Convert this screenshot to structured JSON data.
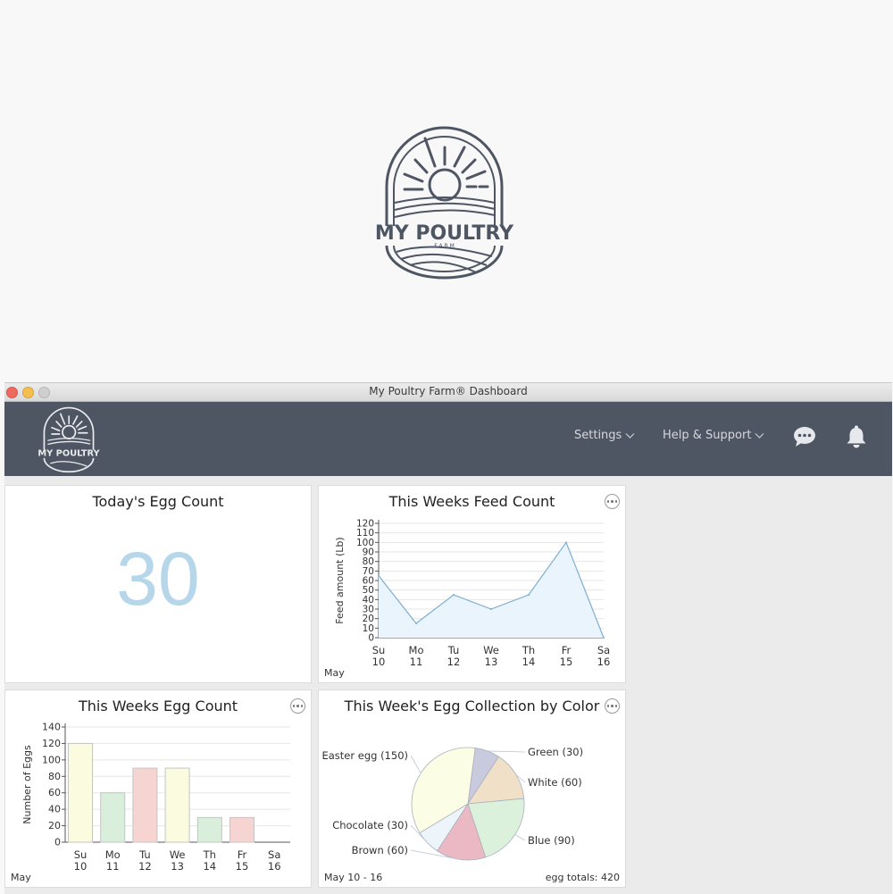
{
  "brand": {
    "logo_main": "MY POULTRY",
    "logo_sub": "F A R M"
  },
  "window": {
    "title": "My Poultry Farm® Dashboard"
  },
  "nav": {
    "settings_label": "Settings",
    "help_label": "Help & Support"
  },
  "icons": {
    "chat": "chat-bubble-icon",
    "notifications": "bell-icon",
    "menu_more": "ellipsis-icon",
    "chevron": "chevron-down-icon"
  },
  "colors": {
    "appbar_bg": "#4e5563",
    "egg_count": "#b6d6ea",
    "line_stroke": "#7eaed0",
    "area_fill": "#eaf4fc"
  },
  "egg_count_panel": {
    "title": "Today's Egg Count",
    "value": "30"
  },
  "feed_panel": {
    "title": "This Weeks Feed Count",
    "footer_month": "May"
  },
  "egg_week_panel": {
    "title": "This Weeks Egg Count",
    "footer_month": "May"
  },
  "color_panel": {
    "title": "This Week's Egg Collection by Color",
    "footer_range": "May 10 - 16",
    "footer_totals": "egg totals: 420"
  },
  "chart_data": [
    {
      "type": "area",
      "title": "This Weeks Feed Count",
      "xlabel": "",
      "ylabel": "Feed amount (Lb)",
      "categories": [
        "Su 10",
        "Mo 11",
        "Tu 12",
        "We 13",
        "Th 14",
        "Fr 15",
        "Sa 16"
      ],
      "day_labels": [
        "Su",
        "Mo",
        "Tu",
        "We",
        "Th",
        "Fr",
        "Sa"
      ],
      "date_labels": [
        "10",
        "11",
        "12",
        "13",
        "14",
        "15",
        "16"
      ],
      "values": [
        65,
        15,
        45,
        30,
        45,
        100,
        0
      ],
      "ylim": [
        0,
        120
      ],
      "yticks": [
        0,
        10,
        20,
        30,
        40,
        50,
        60,
        70,
        80,
        90,
        100,
        110,
        120
      ],
      "grid": true
    },
    {
      "type": "bar",
      "title": "This Weeks Egg Count",
      "xlabel": "",
      "ylabel": "Number of Eggs",
      "categories": [
        "Su 10",
        "Mo 11",
        "Tu 12",
        "We 13",
        "Th 14",
        "Fr 15",
        "Sa 16"
      ],
      "day_labels": [
        "Su",
        "Mo",
        "Tu",
        "We",
        "Th",
        "Fr",
        "Sa"
      ],
      "date_labels": [
        "10",
        "11",
        "12",
        "13",
        "14",
        "15",
        "16"
      ],
      "values": [
        120,
        60,
        90,
        90,
        30,
        30,
        0
      ],
      "bar_colors": [
        "#fbfbe0",
        "#d9eedb",
        "#f6d4d1",
        "#fbfbe0",
        "#d9eedb",
        "#f6d4d1",
        "#fbfbe0"
      ],
      "ylim": [
        0,
        140
      ],
      "yticks": [
        0,
        20,
        40,
        60,
        80,
        100,
        120,
        140
      ],
      "grid": true
    },
    {
      "type": "pie",
      "title": "This Week's Egg Collection by Color",
      "slices": [
        {
          "label": "Green (30)",
          "value": 30,
          "color": "#c9cade"
        },
        {
          "label": "White (60)",
          "value": 60,
          "color": "#f0e0c8"
        },
        {
          "label": "Blue (90)",
          "value": 90,
          "color": "#dcf1dc"
        },
        {
          "label": "Brown (60)",
          "value": 60,
          "color": "#eab9c4"
        },
        {
          "label": "Chocolate (30)",
          "value": 30,
          "color": "#edf5fa"
        },
        {
          "label": "Easter egg (150)",
          "value": 150,
          "color": "#fbfde4"
        }
      ],
      "total": 420
    }
  ]
}
